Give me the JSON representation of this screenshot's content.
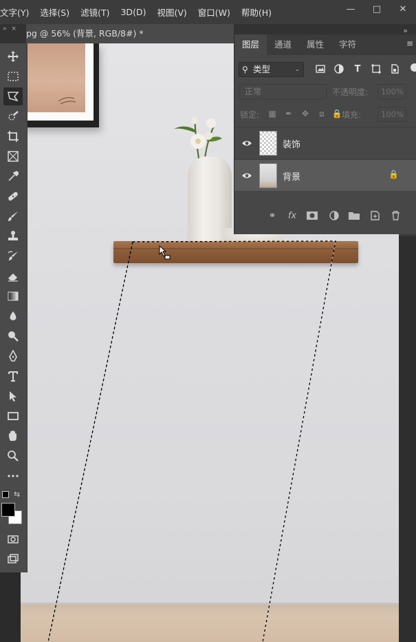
{
  "menubar": {
    "items": [
      "文字(Y)",
      "选择(S)",
      "滤镜(T)",
      "3D(D)",
      "视图(V)",
      "窗口(W)",
      "帮助(H)"
    ],
    "window_controls": [
      "minimize-icon",
      "maximize-icon",
      "close-icon"
    ]
  },
  "document": {
    "tab_title": "pg @ 56% (背景, RGB/8#) *",
    "collapse_glyph": "»"
  },
  "toolbar": {
    "tools": [
      "move-icon",
      "marquee-icon",
      "polygon-lasso-icon",
      "quick-select-icon",
      "crop-icon",
      "frame-icon",
      "eyedropper-icon",
      "healing-icon",
      "brush-icon",
      "stamp-icon",
      "history-brush-icon",
      "eraser-icon",
      "gradient-icon",
      "blur-icon",
      "dodge-icon",
      "pen-icon",
      "type-icon",
      "path-select-icon",
      "rectangle-icon",
      "hand-icon",
      "zoom-icon",
      "more-icon"
    ],
    "active_tool": "polygon-lasso-icon",
    "foreground_color": "#000000",
    "background_color": "#ffffff"
  },
  "layers_panel": {
    "tabs": [
      {
        "label": "图层",
        "active": true
      },
      {
        "label": "通道",
        "active": false
      },
      {
        "label": "属性",
        "active": false
      },
      {
        "label": "字符",
        "active": false
      }
    ],
    "filter": {
      "label": "类型"
    },
    "blend_mode": "正常",
    "opacity_label": "不透明度:",
    "opacity_value": "100%",
    "lock_label": "锁定:",
    "fill_label": "填充:",
    "fill_value": "100%",
    "layers": [
      {
        "name": "装饰",
        "visible": true,
        "selected": false,
        "locked": false
      },
      {
        "name": "背景",
        "visible": true,
        "selected": true,
        "locked": true
      }
    ],
    "footer_icons": [
      "link-icon",
      "fx-icon",
      "mask-icon",
      "adjustment-icon",
      "folder-icon",
      "new-layer-icon",
      "trash-icon"
    ]
  },
  "colors": {
    "ui_dark": "#3c3c3c",
    "panel_bg": "#474747",
    "selected_layer": "#5a5a5a",
    "wall": "#dedee0",
    "shelf": "#8c5d3a"
  }
}
